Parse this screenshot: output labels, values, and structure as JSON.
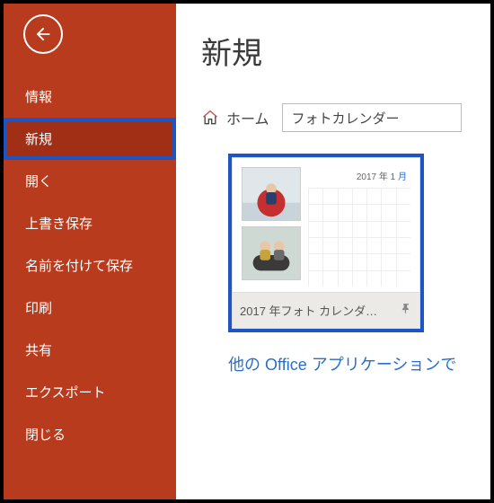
{
  "sidebar": {
    "items": [
      {
        "label": "情報"
      },
      {
        "label": "新規"
      },
      {
        "label": "開く"
      },
      {
        "label": "上書き保存"
      },
      {
        "label": "名前を付けて保存"
      },
      {
        "label": "印刷"
      },
      {
        "label": "共有"
      },
      {
        "label": "エクスポート"
      },
      {
        "label": "閉じる"
      }
    ],
    "activeIndex": 1
  },
  "main": {
    "title": "新規",
    "home_label": "ホーム",
    "search_value": "フォトカレンダー",
    "template": {
      "title": "2017 年フォト カレンダ…",
      "preview_header_year": "2017 年",
      "preview_header_month": "1 月"
    },
    "other_apps_prefix": "他の ",
    "other_apps_office": "Office",
    "other_apps_suffix": " アプリケーションで"
  }
}
